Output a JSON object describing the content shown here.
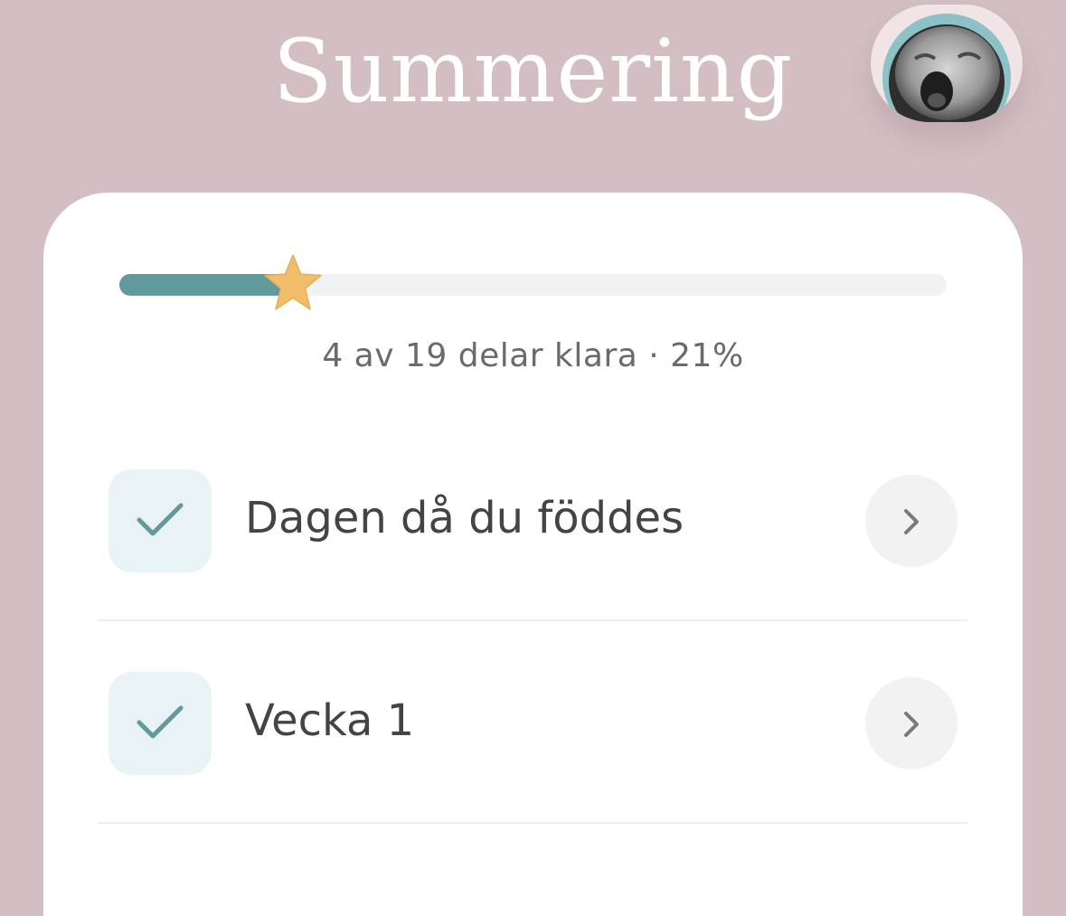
{
  "header": {
    "title": "Summering",
    "avatar_icon": "baby-photo-avatar"
  },
  "progress": {
    "completed": 4,
    "total": 19,
    "percent": 21,
    "fraction": 0.21,
    "text": "4 av 19 delar klara · 21%",
    "marker_icon": "star-icon"
  },
  "colors": {
    "background": "#d3bfc3",
    "accent": "#619a9c",
    "star": "#f0bd6b",
    "card": "#ffffff"
  },
  "list": {
    "items": [
      {
        "label": "Dagen då du föddes",
        "checked": true,
        "check_icon": "checkmark-icon",
        "chevron_icon": "chevron-right-icon"
      },
      {
        "label": "Vecka 1",
        "checked": true,
        "check_icon": "checkmark-icon",
        "chevron_icon": "chevron-right-icon"
      }
    ]
  }
}
